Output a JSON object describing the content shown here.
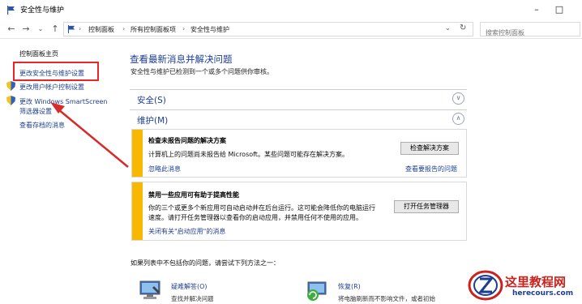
{
  "window": {
    "title": "安全性与维护"
  },
  "address": {
    "crumbs": [
      "控制面板",
      "所有控制面板项",
      "安全性与维护"
    ],
    "search_placeholder": "搜索控制面板"
  },
  "sidebar": {
    "home": "控制面板主页",
    "links": [
      "更改安全性与维护设置",
      "更改用户帐户控制设置",
      "更改 Windows SmartScreen",
      "筛选器设置",
      "查看存档的消息"
    ]
  },
  "main": {
    "heading": "查看最新消息并解决问题",
    "subtitle": "安全性与维护已检测到一个或多个问题供你审核。",
    "security_label": "安全(S)",
    "maintenance_label": "维护(M)",
    "card1": {
      "title": "检查未报告问题的解决方案",
      "text": "计算机上的问题尚未报告给 Microsoft。某些问题可能存在解决方案。",
      "button": "检查解决方案",
      "link_left": "忽略此消息",
      "link_right": "查看要报告的问题"
    },
    "card2": {
      "title": "禁用一些应用可有助于提高性能",
      "text_line1": "你的三个或更多个新应用可自动启动并在后台运行。这可能会降低你的电脑运行",
      "text_line2": "速度。请打开任务管理器以查看你的启动应用，并禁用任何不使用的应用。",
      "button": "打开任务管理器",
      "link": "关闭有关\"启动应用\"的消息"
    },
    "footer_text": "如果列表中不包括你的问题，请尝试下列方法之一：",
    "tools": [
      {
        "title": "疑难解答(O)",
        "desc": "查找并解决问题"
      },
      {
        "title": "恢复(R)",
        "desc": "将电脑刷新而不影响文件，或者初始"
      }
    ]
  },
  "watermark": {
    "text": "这里教程网",
    "url": "herecours.com"
  },
  "colors": {
    "accent": "#1b3d94",
    "warning_bar": "#f8b800",
    "annotation": "#e8262a"
  }
}
